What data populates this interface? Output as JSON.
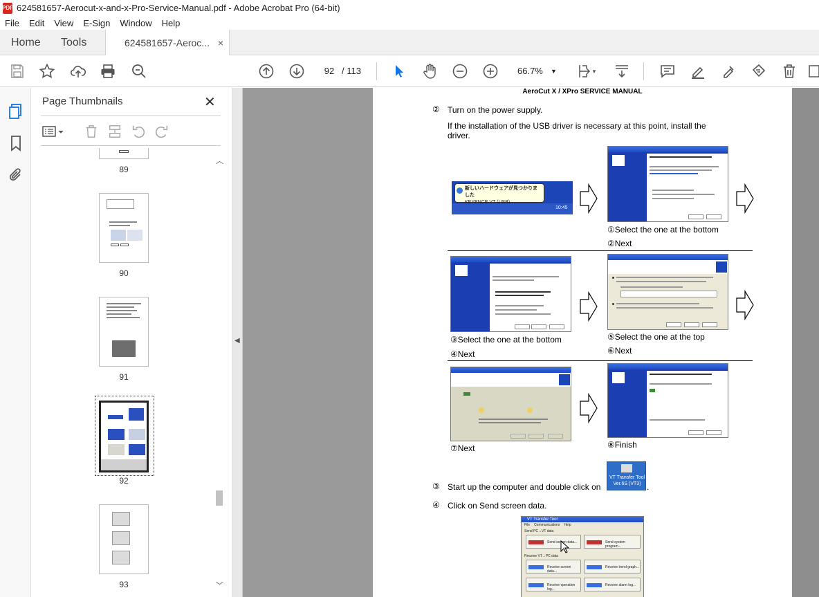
{
  "window": {
    "title": "624581657-Aerocut-x-and-x-Pro-Service-Manual.pdf - Adobe Acrobat Pro (64-bit)",
    "app_icon_text": "PDF"
  },
  "menu": [
    "File",
    "Edit",
    "View",
    "E-Sign",
    "Window",
    "Help"
  ],
  "tabs": {
    "home": "Home",
    "tools": "Tools",
    "document": "624581657-Aeroc...",
    "close": "×"
  },
  "toolbar": {
    "current_page": "92",
    "page_separator": "/",
    "total_pages": "113",
    "zoom": "66.7%"
  },
  "sidebar": {
    "title": "Page Thumbnails",
    "close": "✕",
    "thumbnails": [
      {
        "label": "89"
      },
      {
        "label": "90"
      },
      {
        "label": "91"
      },
      {
        "label": "92",
        "selected": true
      },
      {
        "label": "93"
      }
    ]
  },
  "document": {
    "header": "AeroCut X / XPro SERVICE MANUAL",
    "step2": {
      "num": "②",
      "text": "Turn on the power supply."
    },
    "step2_note": "If the installation of the USB driver is necessary at this point, install the driver.",
    "balloon": {
      "title": "新しいハードウェアが見つかりました",
      "device": "KEYENCE VT (USB)",
      "time": "10:45"
    },
    "captions": {
      "c1": "①Select the one at the bottom",
      "c2": "②Next",
      "c3": "③Select the one at the bottom",
      "c4": "④Next",
      "c5": "⑤Select the one at the top",
      "c6": "⑥Next",
      "c7": "⑦Next",
      "c8": "⑧Finish"
    },
    "step3": {
      "num": "③",
      "text": "Start up the computer and double click on",
      "icon_label": "VT Transfer Tool Ver.6S (VT3)"
    },
    "step4": {
      "num": "④",
      "text": "Click on Send screen data."
    },
    "transfer_tool": {
      "title": "VT Transfer Tool",
      "menus": [
        "File",
        "Communications",
        "Help"
      ],
      "send_group": "Send PC→VT data",
      "send_screen": "Send screen data...",
      "send_system": "Send system program...",
      "receive_group": "Receive VT→PC data",
      "receive_screen": "Receive screen data...",
      "receive_graph": "Receive trend graph...",
      "receive_operation": "Receive operation log...",
      "receive_alarm": "Receive alarm log..."
    }
  }
}
